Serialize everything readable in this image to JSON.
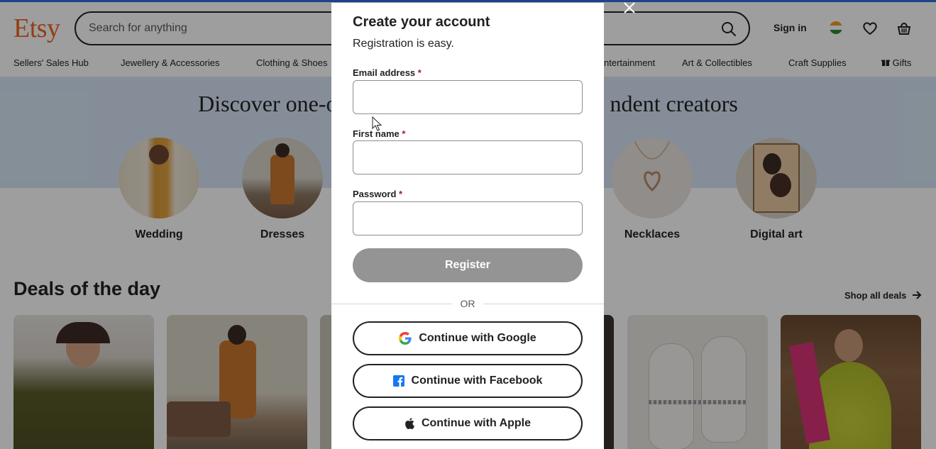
{
  "header": {
    "logo": "Etsy",
    "search_placeholder": "Search for anything",
    "sign_in": "Sign in",
    "colors": {
      "brand": "#f1641e",
      "top_bar": "#2f6fdb"
    }
  },
  "nav": {
    "items": [
      "Sellers' Sales Hub",
      "Jewellery & Accessories",
      "Clothing & Shoes",
      "ntertainment",
      "Art & Collectibles",
      "Craft Supplies",
      "Gifts"
    ]
  },
  "hero": {
    "title_left": "Discover one-o",
    "title_right": "ndent creators"
  },
  "categories": [
    "Wedding",
    "Dresses",
    "Necklaces",
    "Digital art"
  ],
  "deals": {
    "title": "Deals of the day",
    "shop_all": "Shop all deals"
  },
  "modal": {
    "title": "Create your account",
    "subtitle": "Registration is easy.",
    "email_label": "Email address",
    "first_name_label": "First name",
    "password_label": "Password",
    "required_mark": "*",
    "register_button": "Register",
    "or_text": "OR",
    "google_button": "Continue with Google",
    "facebook_button": "Continue with Facebook",
    "apple_button": "Continue with Apple"
  }
}
